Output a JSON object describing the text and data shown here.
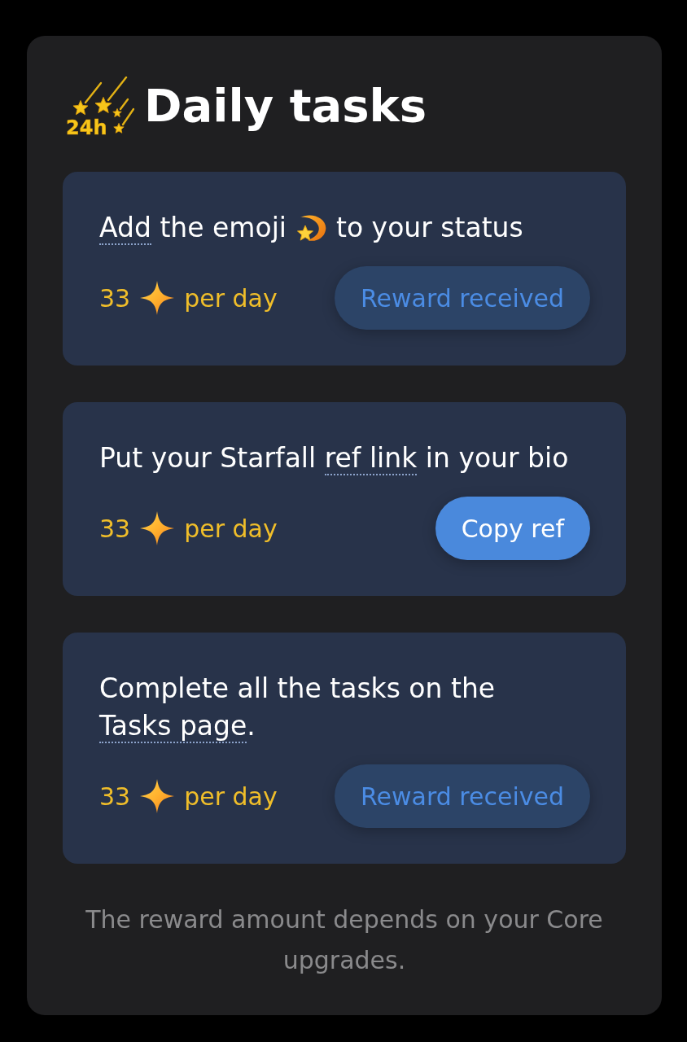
{
  "header": {
    "logo_text": "24h",
    "title": "Daily tasks"
  },
  "tasks": [
    {
      "title_parts": [
        {
          "kind": "link",
          "text": "Add"
        },
        {
          "kind": "plain",
          "text": " the emoji "
        },
        {
          "kind": "emoji"
        },
        {
          "kind": "plain",
          "text": " to your status"
        }
      ],
      "reward": "33",
      "unit": "per day",
      "button": {
        "label": "Reward received",
        "disabled": true
      }
    },
    {
      "title_parts": [
        {
          "kind": "plain",
          "text": "Put your Starfall "
        },
        {
          "kind": "link",
          "text": "ref link"
        },
        {
          "kind": "plain",
          "text": " in your bio"
        }
      ],
      "reward": "33",
      "unit": "per day",
      "button": {
        "label": "Copy ref",
        "disabled": false
      }
    },
    {
      "title_parts": [
        {
          "kind": "plain",
          "text": "Complete all the tasks on the "
        },
        {
          "kind": "link",
          "text": "Tasks page"
        },
        {
          "kind": "plain",
          "text": "."
        }
      ],
      "reward": "33",
      "unit": "per day",
      "button": {
        "label": "Reward received",
        "disabled": true
      }
    }
  ],
  "note": "The reward amount depends on your Core upgrades."
}
